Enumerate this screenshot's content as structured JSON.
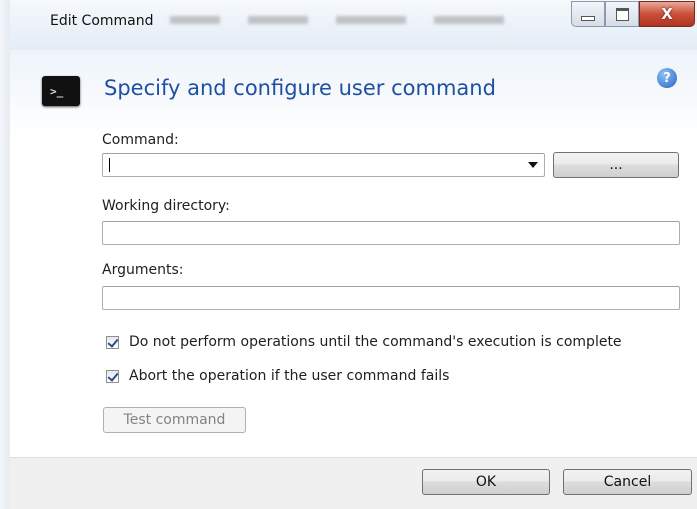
{
  "window": {
    "title": "Edit Command",
    "close_glyph": "X",
    "buttons": [
      "minimize-icon",
      "maximize-icon",
      "close-icon"
    ]
  },
  "header": {
    "heading": "Specify and configure user command",
    "icon": "command-prompt-icon",
    "help_icon": "help-icon",
    "help_glyph": "?"
  },
  "form": {
    "command_label": "Command:",
    "command_value": "",
    "browse_label": "...",
    "working_dir_label": "Working directory:",
    "working_dir_value": "",
    "arguments_label": "Arguments:",
    "arguments_value": "",
    "checkbox_wait": {
      "label": "Do not perform operations until the command's execution is complete",
      "checked": true
    },
    "checkbox_abort": {
      "label": "Abort the operation if the user command fails",
      "checked": true
    },
    "test_button": "Test command"
  },
  "footer": {
    "ok_label": "OK",
    "cancel_label": "Cancel"
  },
  "colors": {
    "heading": "#1e4fa3",
    "close_button": "#c9503a"
  }
}
